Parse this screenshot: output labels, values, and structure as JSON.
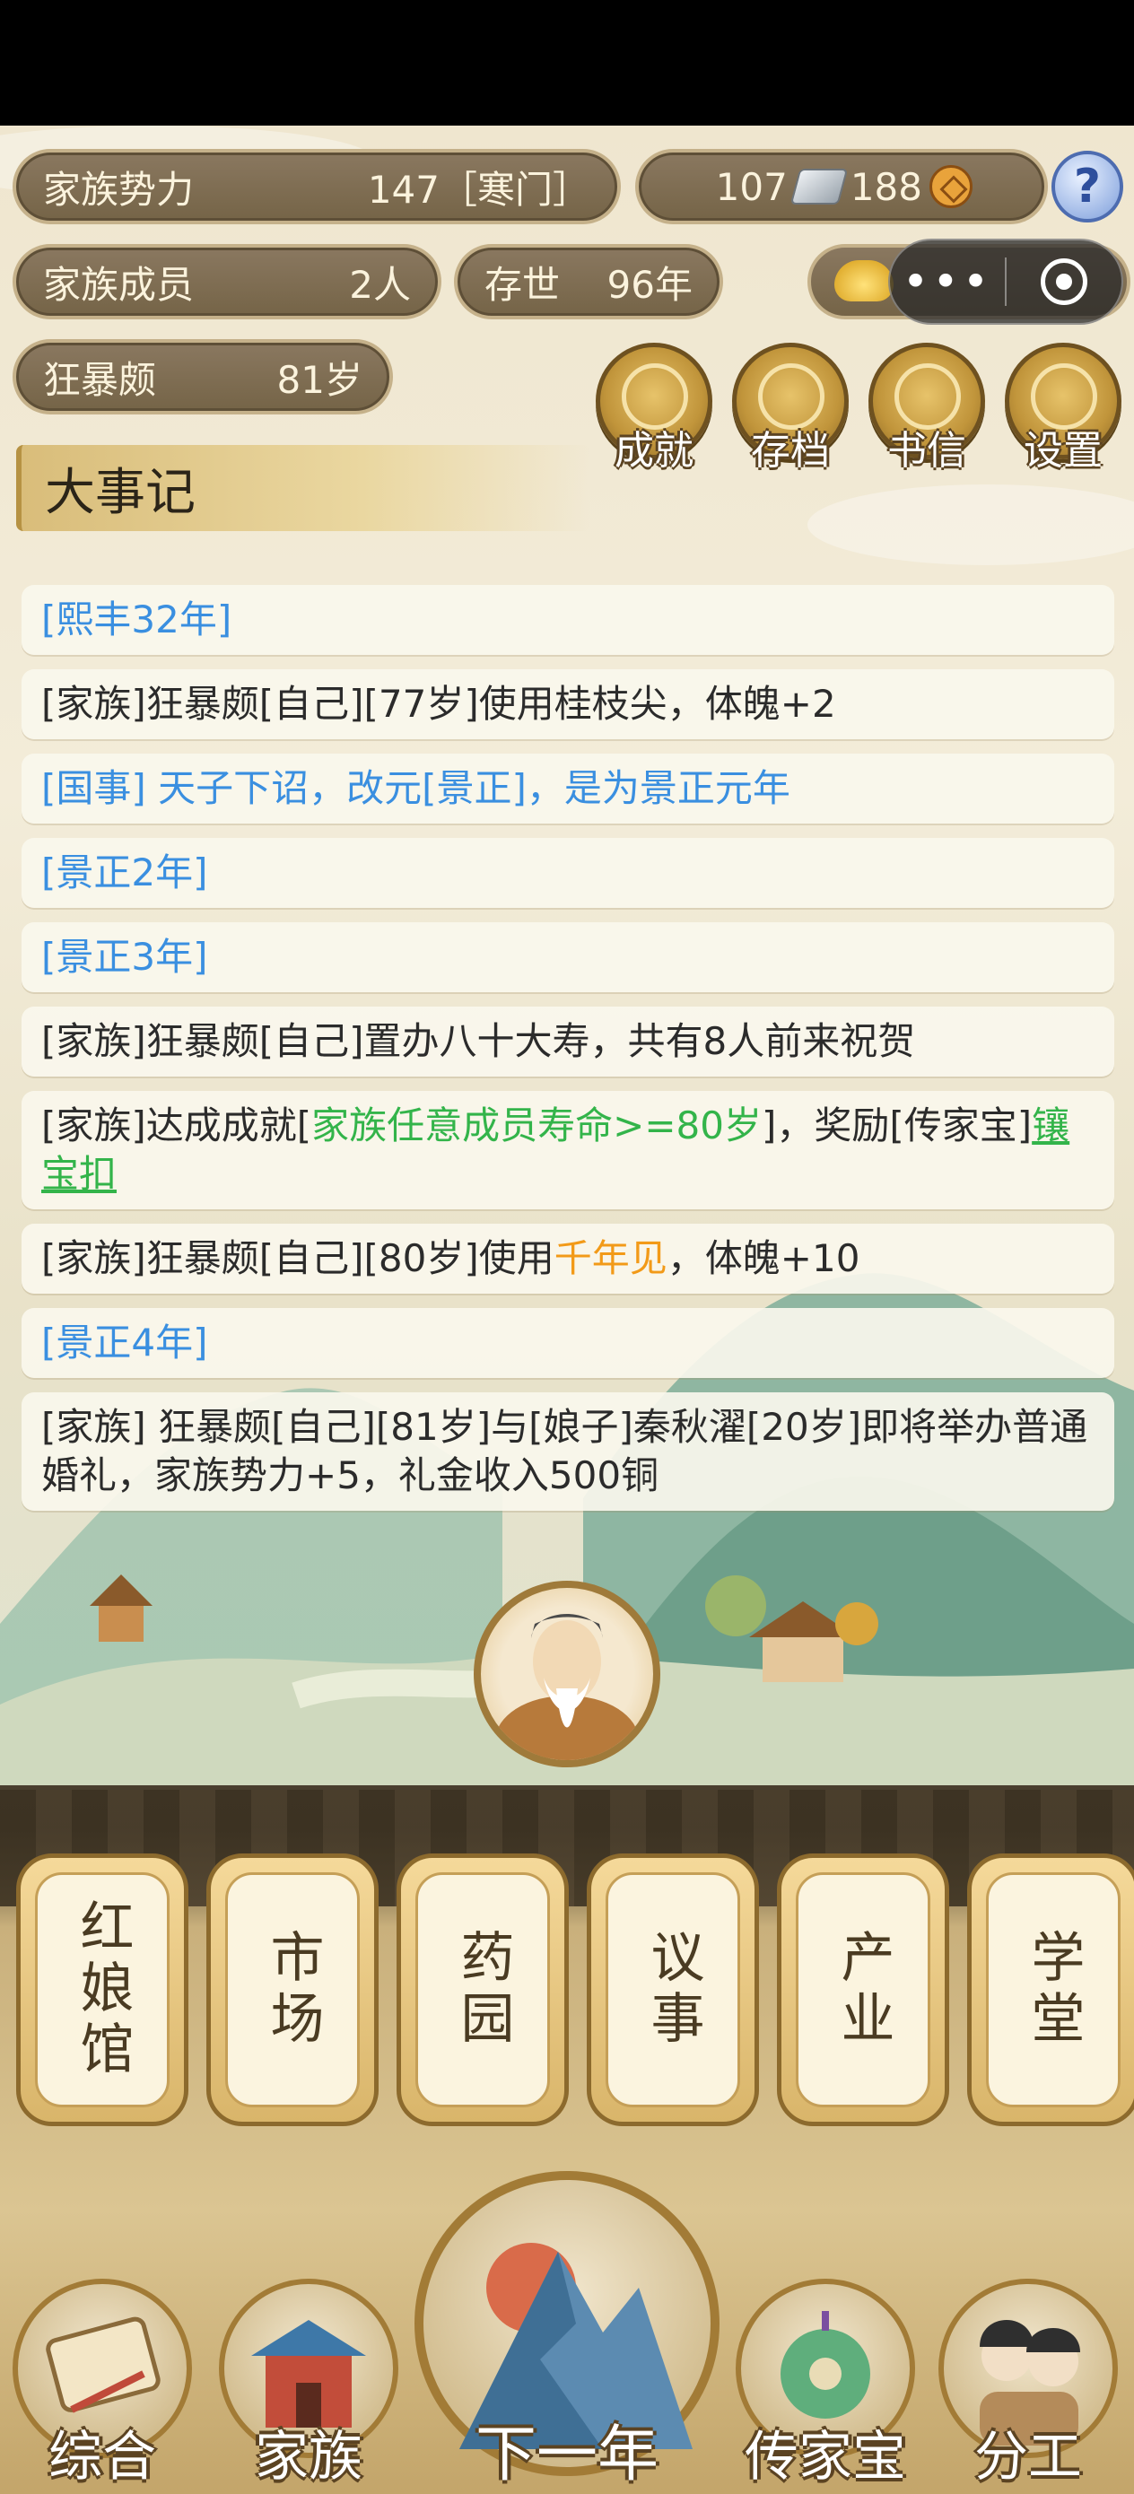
{
  "stats": {
    "power_label": "家族势力",
    "power_value": "147［寒门］",
    "silver": "107",
    "copper": "188",
    "members_label": "家族成员",
    "members_value": "2人",
    "age_label": "存世",
    "age_value": "96年",
    "person_name": "狂暴颇",
    "person_age": "81岁"
  },
  "top_buttons": [
    {
      "label": "成就",
      "icon": "achievement-icon"
    },
    {
      "label": "存档",
      "icon": "save-icon"
    },
    {
      "label": "书信",
      "icon": "letter-icon"
    },
    {
      "label": "设置",
      "icon": "settings-icon"
    }
  ],
  "chronicle": {
    "title": "大事记",
    "entries": [
      {
        "type": "year",
        "text": "[熙丰32年]"
      },
      {
        "type": "event",
        "text": "[家族]狂暴颇[自己][77岁]使用桂枝尖，体魄+2"
      },
      {
        "type": "state",
        "text": "[国事] 天子下诏，改元[景正]，是为景正元年"
      },
      {
        "type": "year",
        "text": "[景正2年]"
      },
      {
        "type": "year",
        "text": "[景正3年]"
      },
      {
        "type": "event",
        "text": "[家族]狂暴颇[自己]置办八十大寿，共有8人前来祝贺"
      },
      {
        "type": "achievement",
        "pre": "[家族]达成成就[",
        "highlight": "家族任意成员寿命>=80岁",
        "mid": "]，奖励[传家宝]",
        "link": "镶宝扣"
      },
      {
        "type": "item",
        "pre": "[家族]狂暴颇[自己][80岁]使用",
        "highlight": "千年见",
        "post": "，体魄+10"
      },
      {
        "type": "year",
        "text": "[景正4年]"
      },
      {
        "type": "event",
        "text": "[家族] 狂暴颇[自己][81岁]与[娘子]秦秋濯[20岁]即将举办普通婚礼，家族势力+5，礼金收入500铜"
      }
    ]
  },
  "buildings": [
    "红娘馆",
    "市场",
    "药园",
    "议事",
    "产业",
    "学堂"
  ],
  "bottom_nav": [
    {
      "label": "综合",
      "icon": "scroll-icon"
    },
    {
      "label": "家族",
      "icon": "house-icon"
    },
    {
      "label": "下一年",
      "icon": "mountain-icon"
    },
    {
      "label": "传家宝",
      "icon": "jade-icon"
    },
    {
      "label": "分工",
      "icon": "people-icon"
    }
  ],
  "colors": {
    "blue_text": "#3a8fe0",
    "green_text": "#33b44a",
    "orange_text": "#f29a18"
  }
}
